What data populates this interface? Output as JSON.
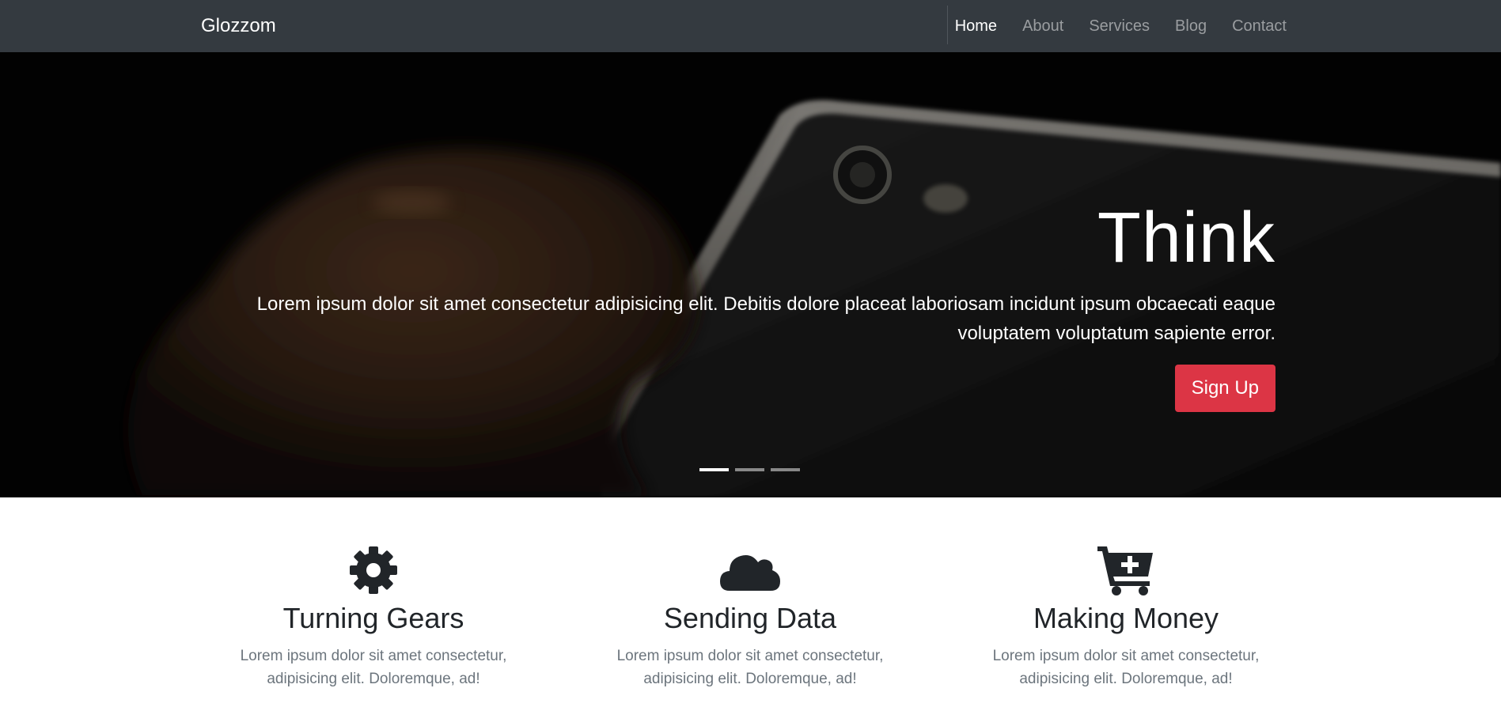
{
  "navbar": {
    "brand": "Glozzom",
    "links": [
      {
        "label": "Home",
        "active": true
      },
      {
        "label": "About",
        "active": false
      },
      {
        "label": "Services",
        "active": false
      },
      {
        "label": "Blog",
        "active": false
      },
      {
        "label": "Contact",
        "active": false
      }
    ]
  },
  "hero": {
    "title": "Think",
    "text": "Lorem ipsum dolor sit amet consectetur adipisicing elit. Debitis dolore placeat laboriosam incidunt ipsum obcaecati eaque voluptatem voluptatum sapiente error.",
    "button": "Sign Up",
    "slides": 3,
    "active_slide": 1,
    "button_color": "#dc3545"
  },
  "features": [
    {
      "icon": "gear-icon",
      "title": "Turning Gears",
      "text": "Lorem ipsum dolor sit amet consectetur, adipisicing elit. Doloremque, ad!"
    },
    {
      "icon": "cloud-icon",
      "title": "Sending Data",
      "text": "Lorem ipsum dolor sit amet consectetur, adipisicing elit. Doloremque, ad!"
    },
    {
      "icon": "cart-plus-icon",
      "title": "Making Money",
      "text": "Lorem ipsum dolor sit amet consectetur, adipisicing elit. Doloremque, ad!"
    }
  ],
  "colors": {
    "navbar_bg": "#343a40",
    "text_dark": "#212529",
    "text_muted": "#6c757d"
  }
}
